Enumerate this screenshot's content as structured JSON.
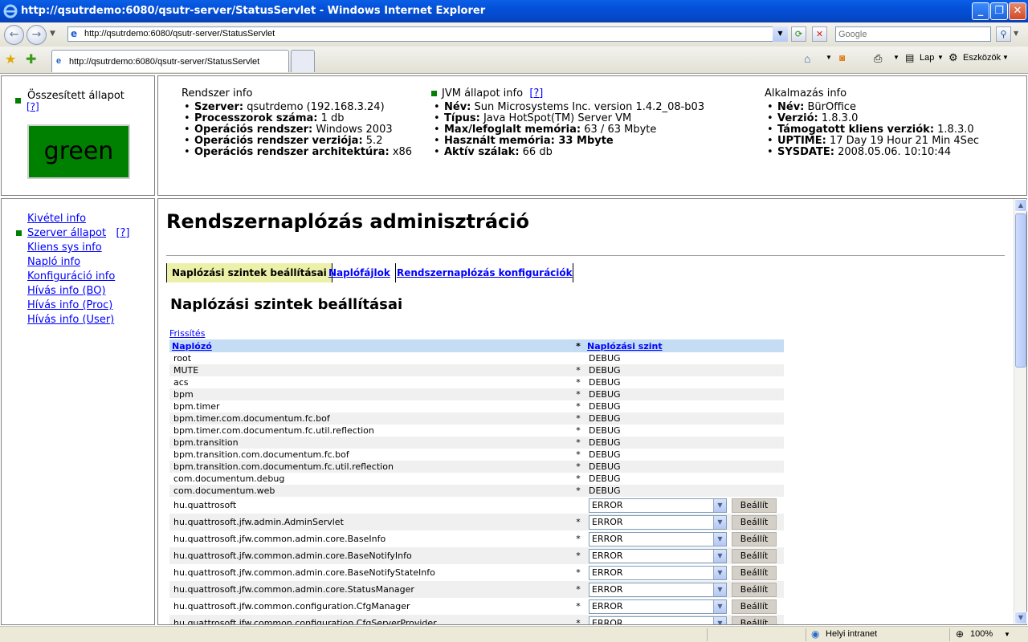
{
  "window": {
    "title": "http://qsutrdemo:6080/qsutr-server/StatusServlet - Windows Internet Explorer"
  },
  "browser": {
    "address": "http://qsutrdemo:6080/qsutr-server/StatusServlet",
    "search_placeholder": "Google",
    "tab_title": "http://qsutrdemo:6080/qsutr-server/StatusServlet",
    "toolbar": {
      "page": "Lap",
      "tools": "Eszközök"
    },
    "status": {
      "zone": "Helyi intranet",
      "zoom": "100%"
    }
  },
  "overall_status": {
    "label": "Összesített állapot",
    "help": "[?]",
    "state": "green"
  },
  "system_info": {
    "title": "Rendszer info",
    "items": [
      {
        "key": "Szerver:",
        "value": " qsutrdemo (192.168.3.24)"
      },
      {
        "key": "Processzorok száma:",
        "value": " 1 db"
      },
      {
        "key": "Operációs rendszer:",
        "value": " Windows 2003"
      },
      {
        "key": "Operációs rendszer verziója:",
        "value": " 5.2"
      },
      {
        "key": "Operációs rendszer architektúra:",
        "value": " x86"
      }
    ]
  },
  "jvm_info": {
    "title": "JVM állapot info",
    "help": "[?]",
    "items": [
      {
        "key": "Név:",
        "value": " Sun Microsystems Inc. version 1.4.2_08-b03"
      },
      {
        "key": "Típus:",
        "value": " Java HotSpot(TM) Server VM"
      },
      {
        "key": "Max/lefoglalt memória:",
        "value": " 63 / 63 Mbyte"
      },
      {
        "key": "Használt memória:",
        "value": " 33 Mbyte"
      },
      {
        "key": "Aktív szálak:",
        "value": " 66 db"
      }
    ]
  },
  "app_info": {
    "title": "Alkalmazás info",
    "items": [
      {
        "key": "Név:",
        "value": " BürOffice"
      },
      {
        "key": "Verzió:",
        "value": " 1.8.3.0"
      },
      {
        "key": "Támogatott kliens verziók:",
        "value": " 1.8.3.0"
      },
      {
        "key": "UPTIME:",
        "value": " 17 Day 19 Hour 21 Min 4Sec"
      },
      {
        "key": "SYSDATE:",
        "value": " 2008.05.06. 10:10:44"
      }
    ]
  },
  "nav": {
    "items": [
      {
        "label": "Kivétel info"
      },
      {
        "label": "Szerver állapot",
        "help": "[?]",
        "active": true
      },
      {
        "label": "Kliens sys info"
      },
      {
        "label": "Napló info"
      },
      {
        "label": "Konfiguráció info"
      },
      {
        "label": "Hívás info (BO)"
      },
      {
        "label": "Hívás info (Proc)"
      },
      {
        "label": "Hívás info (User)"
      }
    ]
  },
  "main": {
    "title": "Rendszernaplózás adminisztráció",
    "tabs": [
      "Naplózási szintek beállításai",
      "Naplófájlok",
      "Rendszernaplózás konfigurációk"
    ],
    "section_title": "Naplózási szintek beállításai",
    "refresh": "Frissítés",
    "table": {
      "col_logger": "Naplózó",
      "col_star": "*",
      "col_level": "Naplózási szint",
      "set_label": "Beállít",
      "rows": [
        {
          "name": "root",
          "star": "",
          "level": "DEBUG"
        },
        {
          "name": "MUTE",
          "star": "*",
          "level": "DEBUG"
        },
        {
          "name": "acs",
          "star": "*",
          "level": "DEBUG"
        },
        {
          "name": "bpm",
          "star": "*",
          "level": "DEBUG"
        },
        {
          "name": "bpm.timer",
          "star": "*",
          "level": "DEBUG"
        },
        {
          "name": "bpm.timer.com.documentum.fc.bof",
          "star": "*",
          "level": "DEBUG"
        },
        {
          "name": "bpm.timer.com.documentum.fc.util.reflection",
          "star": "*",
          "level": "DEBUG"
        },
        {
          "name": "bpm.transition",
          "star": "*",
          "level": "DEBUG"
        },
        {
          "name": "bpm.transition.com.documentum.fc.bof",
          "star": "*",
          "level": "DEBUG"
        },
        {
          "name": "bpm.transition.com.documentum.fc.util.reflection",
          "star": "*",
          "level": "DEBUG"
        },
        {
          "name": "com.documentum.debug",
          "star": "*",
          "level": "DEBUG"
        },
        {
          "name": "com.documentum.web",
          "star": "*",
          "level": "DEBUG"
        },
        {
          "name": "hu.quattrosoft",
          "star": "",
          "level": "ERROR",
          "editable": true
        },
        {
          "name": "hu.quattrosoft.jfw.admin.AdminServlet",
          "star": "*",
          "level": "ERROR",
          "editable": true
        },
        {
          "name": "hu.quattrosoft.jfw.common.admin.core.BaseInfo",
          "star": "*",
          "level": "ERROR",
          "editable": true
        },
        {
          "name": "hu.quattrosoft.jfw.common.admin.core.BaseNotifyInfo",
          "star": "*",
          "level": "ERROR",
          "editable": true
        },
        {
          "name": "hu.quattrosoft.jfw.common.admin.core.BaseNotifyStateInfo",
          "star": "*",
          "level": "ERROR",
          "editable": true
        },
        {
          "name": "hu.quattrosoft.jfw.common.admin.core.StatusManager",
          "star": "*",
          "level": "ERROR",
          "editable": true
        },
        {
          "name": "hu.quattrosoft.jfw.common.configuration.CfgManager",
          "star": "*",
          "level": "ERROR",
          "editable": true
        },
        {
          "name": "hu.quattrosoft.jfw.common.configuration.CfgServerProvider",
          "star": "*",
          "level": "ERROR",
          "editable": true
        }
      ]
    }
  }
}
